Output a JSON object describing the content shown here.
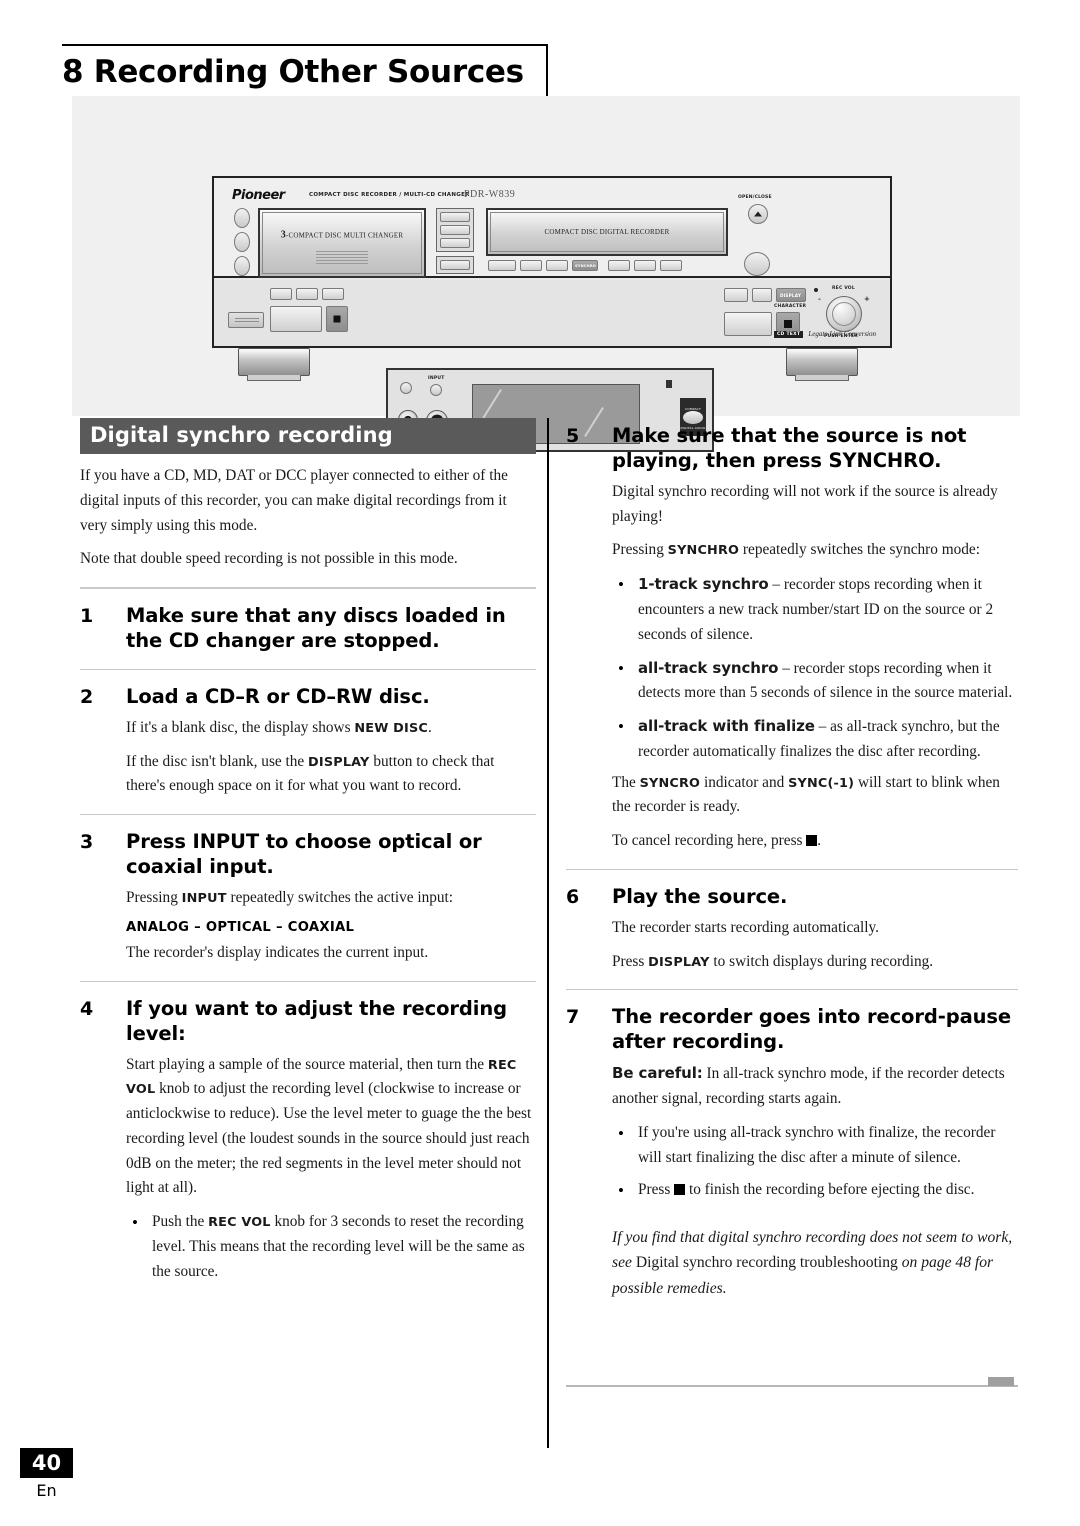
{
  "page": {
    "chapter_title": "8 Recording Other Sources",
    "number": "40",
    "language": "En"
  },
  "figure": {
    "brand": "Pioneer",
    "brand_subtitle": "COMPACT DISC RECORDER / MULTI-CD CHANGER",
    "model": "PDR-W839",
    "changer_tray_label_number": "3",
    "changer_tray_label": "-COMPACT DISC MULTI CHANGER",
    "recorder_tray_label": "COMPACT DISC DIGITAL RECORDER",
    "open_close_label": "OPEN/CLOSE",
    "input_label": "INPUT",
    "synchro_button_label": "SYNCHRO",
    "display_button_label": "DISPLAY",
    "character_label": "CHARACTER",
    "rec_vol_label": "REC VOL",
    "rec_vol_minus": "–",
    "rec_vol_plus": "+",
    "push_enter_label": "PUSH ENTER",
    "cd_text_badge": "CD TEXT",
    "legato_text": "Legato Link Conversion",
    "cd_logo_text": "COMPACT",
    "cd_logo_text2": "DIGITAL AUDIO"
  },
  "left_column": {
    "banner": "Digital synchro recording",
    "intro": "If you have a CD, MD, DAT or DCC player connected to either of the digital inputs of this recorder, you can make digital recordings from it very simply using this mode.",
    "note": "Note that double speed recording is not possible in this mode.",
    "steps": [
      {
        "num": "1",
        "title": "Make sure that any discs loaded in the CD changer are stopped.",
        "paras": []
      },
      {
        "num": "2",
        "title": "Load a CD–R or CD–RW disc.",
        "para1_a": "If it's a blank disc, the display shows ",
        "para1_kw": "NEW DISC",
        "para1_b": ".",
        "para2_a": "If the disc isn't blank, use the ",
        "para2_kw": "DISPLAY",
        "para2_b": " button to check that there's enough space on it for what you want to record."
      },
      {
        "num": "3",
        "title": "Press INPUT to choose optical or coaxial input.",
        "para1_a": "Pressing ",
        "para1_kw": "INPUT",
        "para1_b": " repeatedly switches the active input:",
        "sequence": "ANALOG – OPTICAL – COAXIAL",
        "para2": "The recorder's display indicates the current input."
      },
      {
        "num": "4",
        "title": "If you want to adjust the recording level:",
        "para1_a": "Start playing a sample of the source material, then turn the ",
        "para1_kw": "REC VOL",
        "para1_b": " knob to adjust the recording level (clockwise to increase or anticlockwise to reduce). Use the level meter to guage the the best recording level (the loudest sounds in the source should just reach 0dB on the meter; the red segments in the level meter  should not light at all).",
        "bullet_a": "Push the ",
        "bullet_kw": "REC VOL",
        "bullet_b": " knob for 3 seconds to reset the recording level. This means that the recording level will be the same as the source."
      }
    ]
  },
  "right_column": {
    "steps": [
      {
        "num": "5",
        "title": "Make sure that the source is not playing, then press SYNCHRO.",
        "para1": "Digital synchro recording will not work if the source is already playing!",
        "para2_a": "Pressing ",
        "para2_kw": "SYNCHRO",
        "para2_b": " repeatedly switches the synchro mode:",
        "bullets": [
          {
            "term": "1-track synchro",
            "rest": " – recorder stops recording when it encounters a new track number/start ID on the source or 2 seconds of silence."
          },
          {
            "term": "all-track synchro",
            "rest": " – recorder stops recording when it detects more than 5 seconds of silence in the source material."
          },
          {
            "term": "all-track with finalize",
            "rest": " – as all-track synchro, but the recorder automatically finalizes the disc after recording."
          }
        ],
        "para3_a": "The ",
        "para3_kw1": "SYNCRO",
        "para3_b": " indicator and ",
        "para3_kw2": "SYNC(-1)",
        "para3_c": " will start to blink when the recorder is ready.",
        "para4_a": "To cancel recording here, press ",
        "para4_b": "."
      },
      {
        "num": "6",
        "title": "Play the source.",
        "para1": "The recorder starts recording automatically.",
        "para2_a": "Press ",
        "para2_kw": "DISPLAY",
        "para2_b": " to switch displays during recording."
      },
      {
        "num": "7",
        "title": "The recorder goes into record-pause after recording.",
        "para1_kw": "Be careful:",
        "para1_rest": " In all-track synchro mode, if the recorder detects another signal, recording starts again.",
        "bullets": [
          {
            "term": "",
            "rest": "If you're using all-track synchro with finalize, the recorder will start finalizing the disc after a minute of silence."
          }
        ],
        "bullet2_a": "Press ",
        "bullet2_b": " to finish the recording before ejecting the disc."
      }
    ],
    "closing_note_a": "If you find that digital synchro recording does not seem to work, see ",
    "closing_note_upright": "Digital synchro recording troubleshooting",
    "closing_note_b": " on page 48 for possible remedies."
  }
}
